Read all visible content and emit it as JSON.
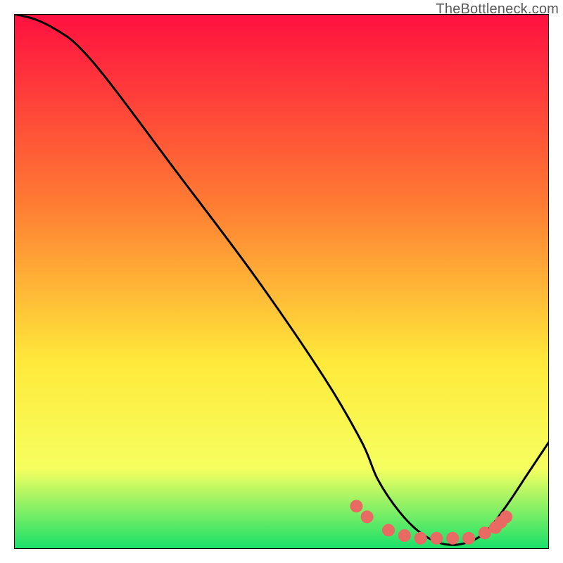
{
  "watermark": "TheBottleneck.com",
  "colors": {
    "gradient_top": "#ff1040",
    "gradient_mid1": "#ff7a33",
    "gradient_mid2": "#ffe93a",
    "gradient_mid3": "#f6ff60",
    "gradient_bottom": "#17e06a",
    "curve": "#000000",
    "marker": "#e86a63",
    "plot_border": "#000000"
  },
  "chart_data": {
    "type": "line",
    "title": "",
    "xlabel": "",
    "ylabel": "",
    "xlim": [
      0,
      100
    ],
    "ylim": [
      0,
      100
    ],
    "series": [
      {
        "name": "bottleneck-curve",
        "x": [
          0,
          4,
          8,
          12,
          18,
          30,
          45,
          58,
          65,
          68,
          72,
          76,
          80,
          84,
          88,
          92,
          96,
          100
        ],
        "values": [
          100,
          99,
          97,
          94,
          87,
          71,
          51,
          32,
          20,
          13,
          7,
          3,
          1,
          1,
          3,
          8,
          14,
          20
        ]
      }
    ],
    "markers": {
      "name": "highlight-dots",
      "x": [
        64,
        66,
        70,
        73,
        76,
        79,
        82,
        85,
        88,
        90,
        91,
        92
      ],
      "values": [
        8,
        6,
        3.5,
        2.5,
        2,
        2,
        2,
        2,
        3,
        4,
        5,
        6
      ]
    }
  }
}
